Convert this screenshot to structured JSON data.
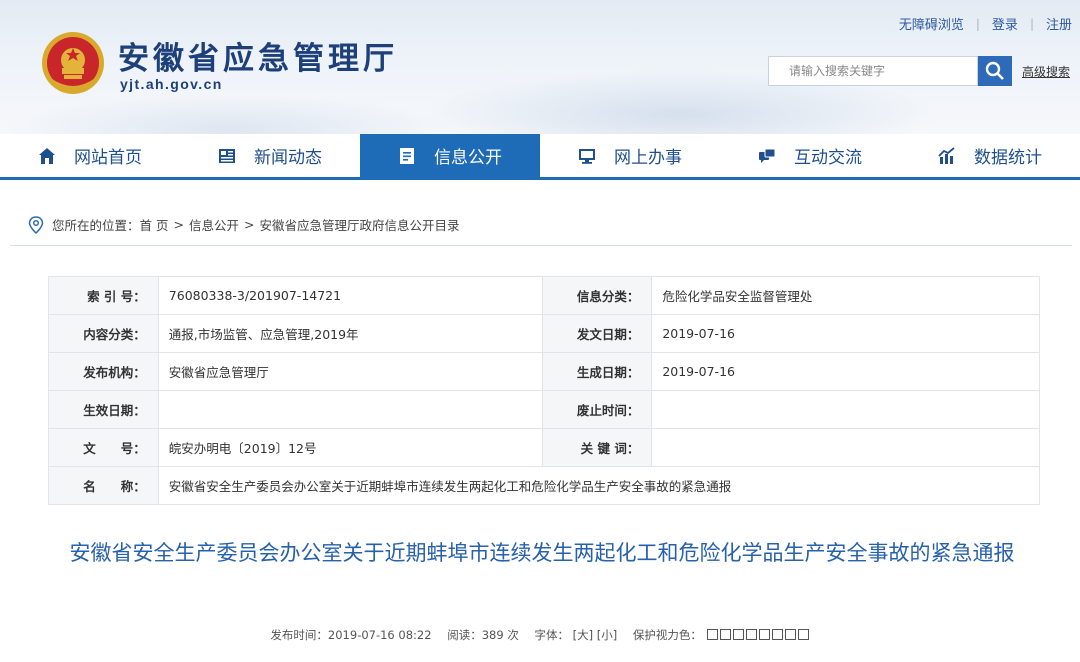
{
  "header": {
    "site_name": "安徽省应急管理厅",
    "site_domain": "yjt.ah.gov.cn",
    "toplinks": [
      "无障碍浏览",
      "登录",
      "注册"
    ],
    "search_placeholder": "请输入搜索关键字",
    "advanced_search": "高级搜索"
  },
  "nav": {
    "items": [
      {
        "label": "网站首页",
        "icon": "home-icon"
      },
      {
        "label": "新闻动态",
        "icon": "newspaper-icon"
      },
      {
        "label": "信息公开",
        "icon": "document-icon"
      },
      {
        "label": "网上办事",
        "icon": "monitor-icon"
      },
      {
        "label": "互动交流",
        "icon": "chat-icon"
      },
      {
        "label": "数据统计",
        "icon": "chart-icon"
      }
    ],
    "active": "信息公开"
  },
  "breadcrumb": {
    "prefix": "您所在的位置：",
    "items": [
      "首 页",
      "信息公开",
      "安徽省应急管理厅政府信息公开目录"
    ]
  },
  "info": {
    "index_label": "索 引 号：",
    "index_value": "76080338-3/201907-14721",
    "category_label": "信息分类：",
    "category_value": "危险化学品安全监督管理处",
    "content_label": "内容分类：",
    "content_value": "通报,市场监管、应急管理,2019年",
    "issue_date_label": "发文日期：",
    "issue_date_value": "2019-07-16",
    "publisher_label": "发布机构：",
    "publisher_value": "安徽省应急管理厅",
    "gen_date_label": "生成日期：",
    "gen_date_value": "2019-07-16",
    "effective_label": "生效日期：",
    "effective_value": "",
    "abolish_label": "废止时间：",
    "abolish_value": "",
    "doc_no_label": "文　　号：",
    "doc_no_value": "皖安办明电〔2019〕12号",
    "keywords_label": "关 键 词：",
    "keywords_value": "",
    "name_label": "名　　称：",
    "name_value": "安徽省安全生产委员会办公室关于近期蚌埠市连续发生两起化工和危险化学品生产安全事故的紧急通报"
  },
  "article": {
    "title": "安徽省安全生产委员会办公室关于近期蚌埠市连续发生两起化工和危险化学品生产安全事故的紧急通报",
    "publish_label": "发布时间：2019-07-16 08:22",
    "reads_label": "阅读：389 次",
    "font_label": "字体：",
    "font_big": "[大]",
    "font_small": "[小]",
    "eye_label": "保护视力色："
  },
  "colors": {
    "brand": "#1d3f7a",
    "accent": "#1e6bb8",
    "title": "#2760ab"
  }
}
